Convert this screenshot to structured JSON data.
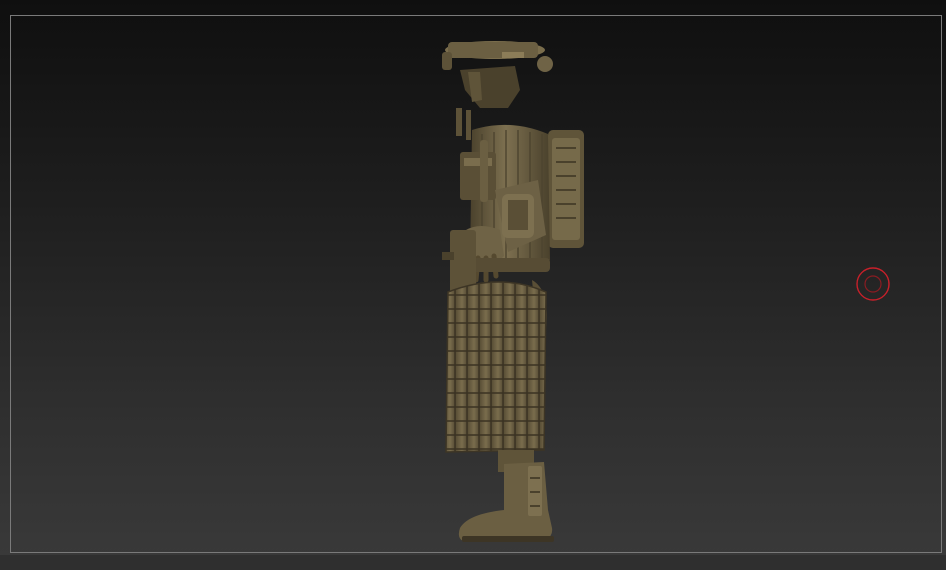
{
  "viewport": {
    "background_top": "#0f0f0f",
    "background_bottom": "#3a3a3a",
    "frame_color": "#7a7a7a"
  },
  "model": {
    "material_color": "#6b5f42",
    "highlight_color": "#8c7d58",
    "shadow_color": "#3d3525"
  },
  "brush_cursor": {
    "icon": "brush-circle-icon",
    "color": "#c8202a"
  }
}
